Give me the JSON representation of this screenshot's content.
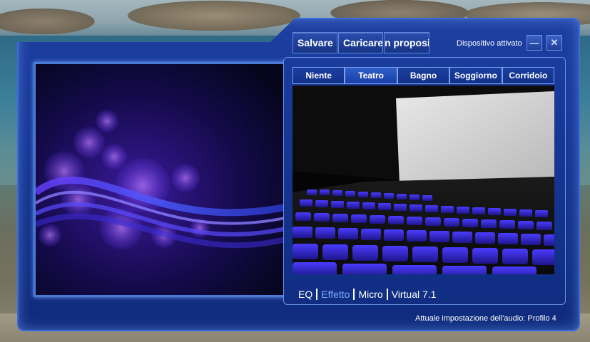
{
  "toolbar": {
    "save_label": "Salvare",
    "load_label": "Caricare",
    "about_label": "n proposito"
  },
  "window": {
    "device_status": "Dispositivo attivato",
    "minimize_symbol": "—",
    "close_symbol": "✕"
  },
  "environment_tabs": [
    {
      "label": "Niente",
      "active": false
    },
    {
      "label": "Teatro",
      "active": true
    },
    {
      "label": "Bagno",
      "active": false
    },
    {
      "label": "Soggiorno",
      "active": false
    },
    {
      "label": "Corridoio",
      "active": false
    }
  ],
  "bottom_tabs": [
    {
      "label": "EQ",
      "active": false
    },
    {
      "label": "Effetto",
      "active": true
    },
    {
      "label": "Micro",
      "active": false
    },
    {
      "label": "Virtual 7.1",
      "active": false
    }
  ],
  "footer": {
    "status": "Attuale impostazione dell'audio: Profilo 4"
  },
  "colors": {
    "frame": "#163795",
    "frame_border": "#3b6be0",
    "active_bottom_tab": "#7aa8ff",
    "seat": "#3a2fd8"
  }
}
